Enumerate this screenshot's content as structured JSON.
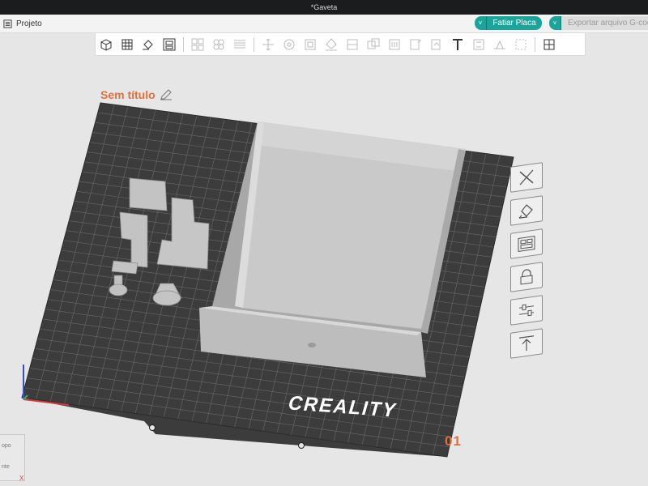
{
  "window": {
    "title": "*Gaveta"
  },
  "menu": {
    "project_label": "Projeto"
  },
  "actions": {
    "slice_label": "Fatiar Placa",
    "export_label": "Exportar arquivo G-code",
    "dropdown_glyph": "˅"
  },
  "toolbar": {
    "icons": [
      "add-object",
      "grid-arrange",
      "auto-orient",
      "layout-plate",
      "split-objects",
      "split-parts",
      "layers",
      "move",
      "rotate",
      "scale",
      "flatten",
      "cut",
      "boolean",
      "support-paint",
      "seam-paint",
      "mmu-paint",
      "text",
      "height-range",
      "measure",
      "assembly",
      "puzzle"
    ]
  },
  "plate": {
    "name": "Sem título",
    "number": "01",
    "brand": "CREALITY",
    "accent": "#e2703b"
  },
  "side_tools": [
    "delete-plate",
    "auto-orient",
    "arrange",
    "lock",
    "settings",
    "move-top"
  ],
  "view_cube": {
    "face_top": "opo",
    "face_side": "nte",
    "axis": "X"
  },
  "colors": {
    "accent": "#1aa49a",
    "bed": "#3c3c3c",
    "grid": "#6a6a6a",
    "model": "#c6c6c6"
  }
}
